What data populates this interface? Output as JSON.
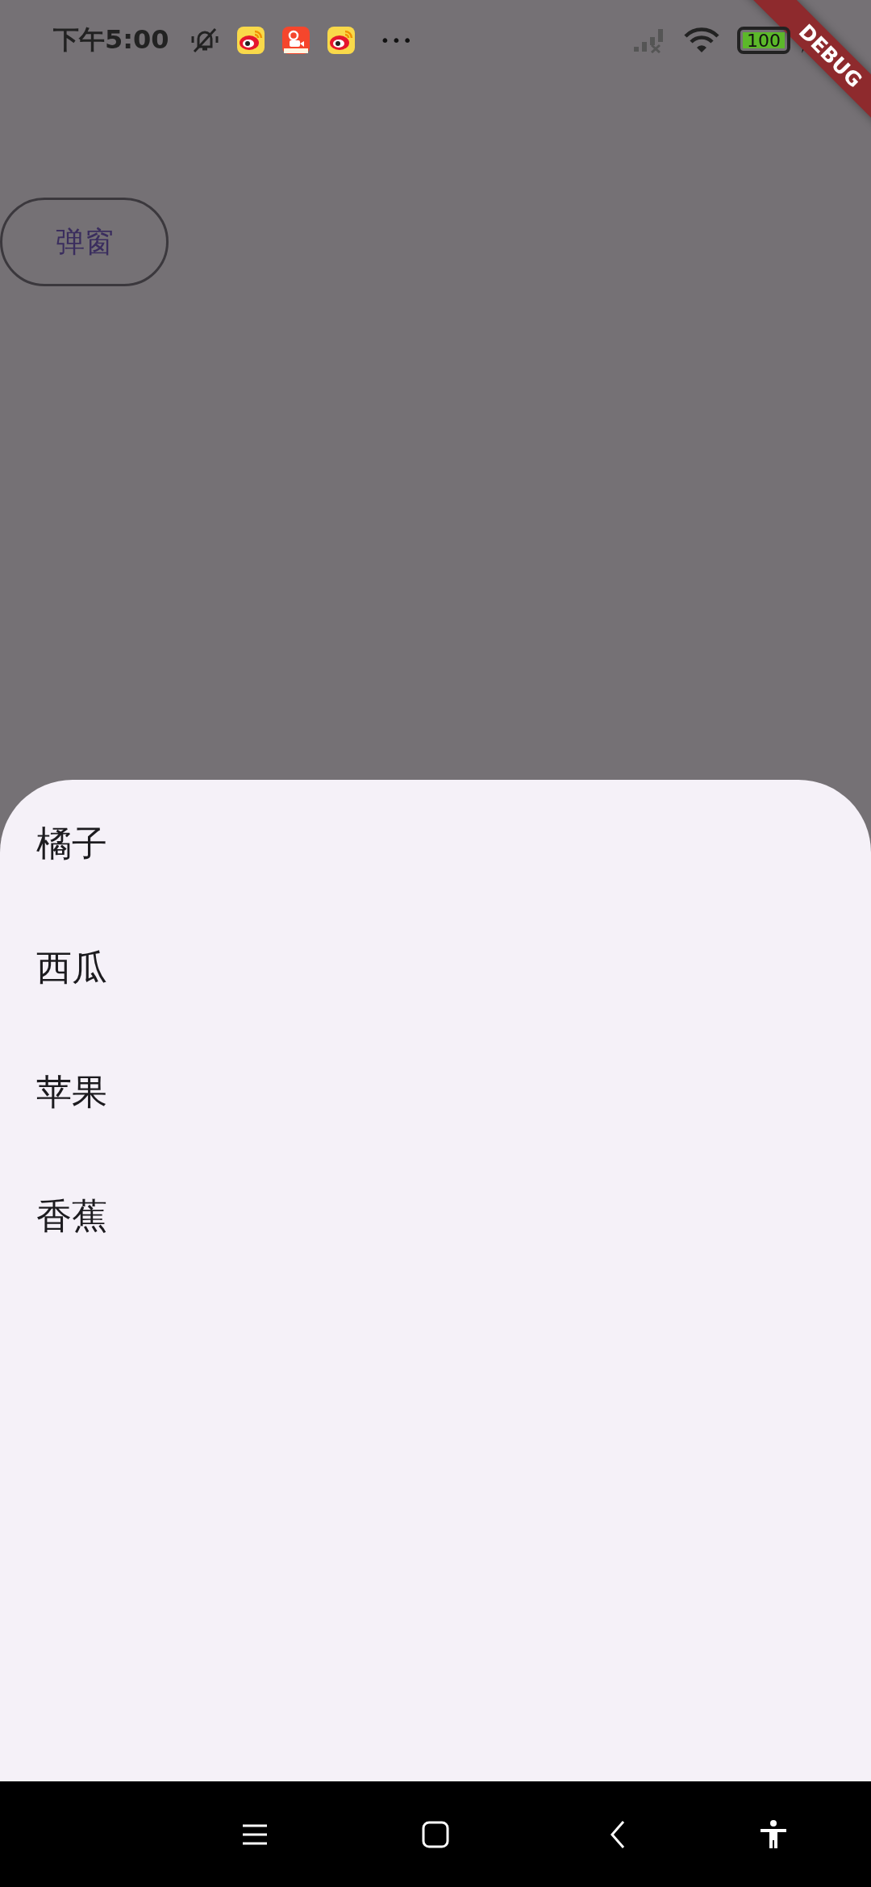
{
  "status_bar": {
    "time": "下午5:00",
    "more": "•••",
    "battery": "100"
  },
  "debug_banner": "DEBUG",
  "button": {
    "label": "弹窗"
  },
  "bottom_sheet": {
    "items": [
      {
        "label": "橘子"
      },
      {
        "label": "西瓜"
      },
      {
        "label": "苹果"
      },
      {
        "label": "香蕉"
      }
    ]
  }
}
